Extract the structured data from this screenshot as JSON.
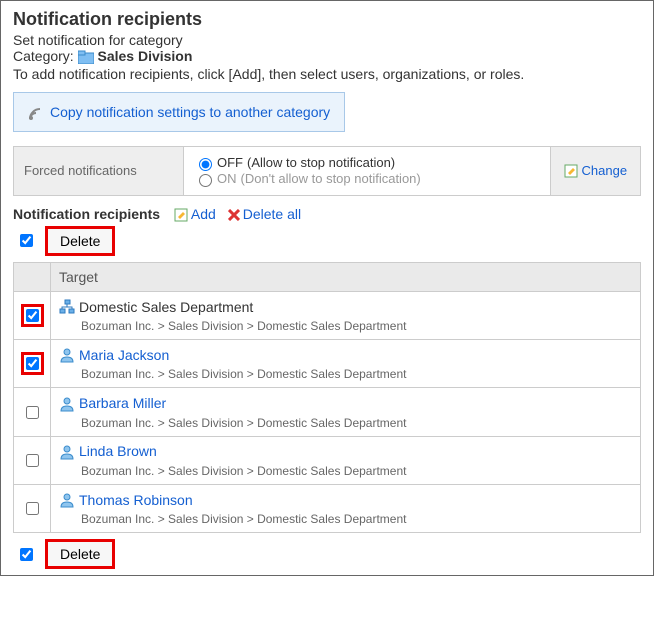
{
  "header": {
    "title": "Notification recipients",
    "subhead": "Set notification for category",
    "categoryLabel": "Category:",
    "categoryName": "Sales Division",
    "desc": "To add notification recipients, click [Add], then select users, organizations, or roles."
  },
  "copyLink": "Copy notification settings to another category",
  "forced": {
    "label": "Forced notifications",
    "offLabel": "OFF",
    "offHint": "(Allow to stop notification)",
    "onLabel": "ON",
    "onHint": "(Don't allow to stop notification)",
    "change": "Change",
    "selected": "off"
  },
  "listLabel": "Notification recipients",
  "actions": {
    "add": "Add",
    "deleteAll": "Delete all",
    "delete": "Delete"
  },
  "columns": {
    "target": "Target"
  },
  "targets": [
    {
      "type": "org",
      "name": "Domestic Sales Department",
      "path": "Bozuman Inc. > Sales Division > Domestic Sales Department",
      "checked": true,
      "hl": true,
      "link": false
    },
    {
      "type": "user",
      "name": "Maria Jackson",
      "path": "Bozuman Inc. > Sales Division > Domestic Sales Department",
      "checked": true,
      "hl": true,
      "link": true
    },
    {
      "type": "user",
      "name": "Barbara Miller",
      "path": "Bozuman Inc. > Sales Division > Domestic Sales Department",
      "checked": false,
      "hl": false,
      "link": true
    },
    {
      "type": "user",
      "name": "Linda Brown",
      "path": "Bozuman Inc. > Sales Division > Domestic Sales Department",
      "checked": false,
      "hl": false,
      "link": true
    },
    {
      "type": "user",
      "name": "Thomas Robinson",
      "path": "Bozuman Inc. > Sales Division > Domestic Sales Department",
      "checked": false,
      "hl": false,
      "link": true
    }
  ]
}
